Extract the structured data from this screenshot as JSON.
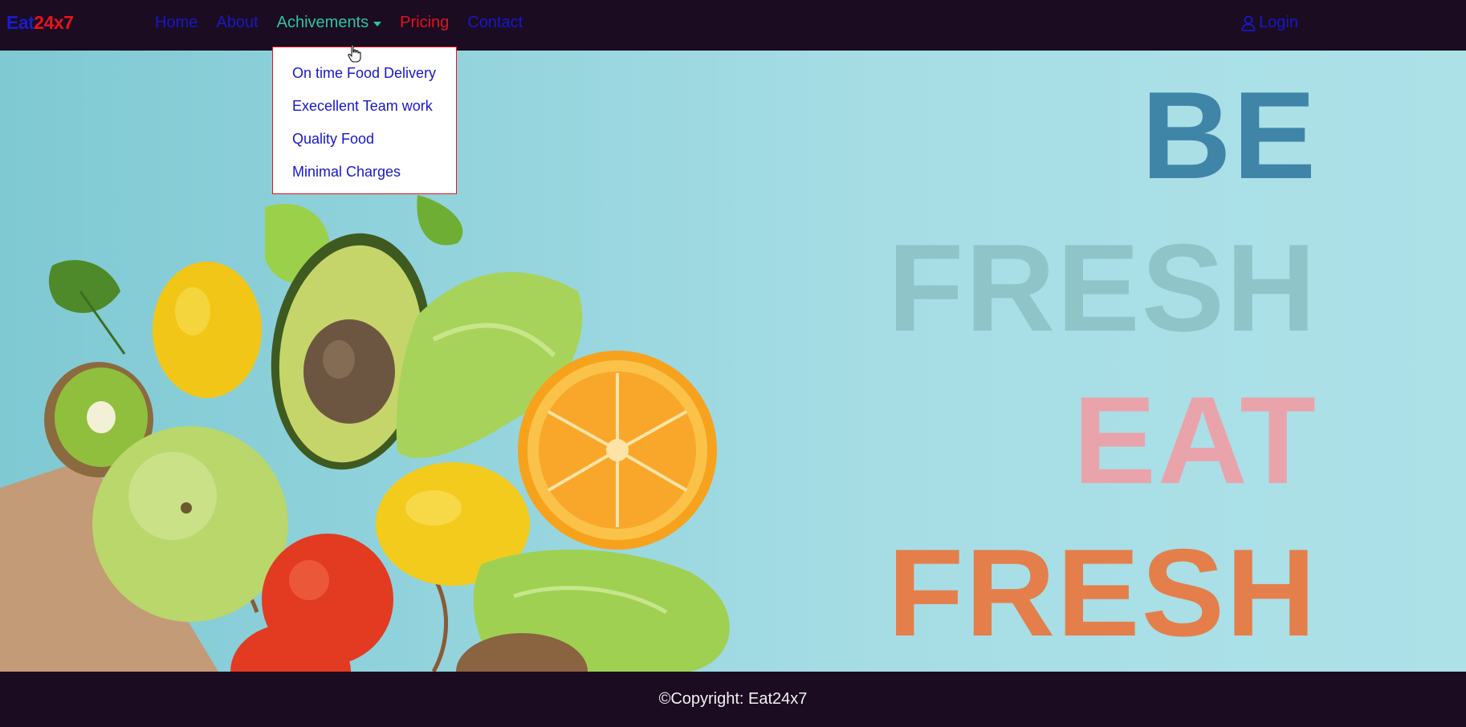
{
  "navbar": {
    "brand_part1": "Eat",
    "brand_part2": "24x7",
    "links": {
      "home": "Home",
      "about": "About",
      "achievements": "Achivements",
      "pricing": "Pricing",
      "contact": "Contact"
    },
    "login": "Login"
  },
  "dropdown": {
    "items": [
      "On time Food Delivery",
      "Execellent Team work",
      "Quality Food",
      "Minimal Charges"
    ]
  },
  "hero": {
    "slogan": [
      "BE",
      "FRESH",
      "EAT",
      "FRESH"
    ]
  },
  "footer": {
    "copyright": "©Copyright: Eat24x7"
  },
  "colors": {
    "navbar_bg": "#1b0c22",
    "link_blue": "#1818c8",
    "brand_red": "#e8141c",
    "active_teal": "#2ec4a0",
    "hero_bg": "#a6dde5"
  },
  "icons": {
    "login": "user-icon",
    "dropdown": "caret-down-icon",
    "cursor": "hand-pointer-icon"
  }
}
